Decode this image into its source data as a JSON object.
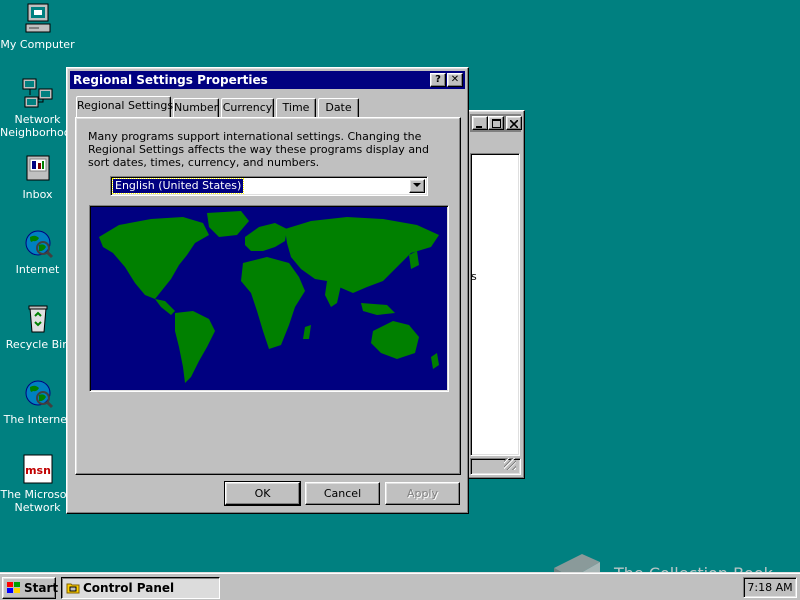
{
  "desktop_icons": [
    {
      "label": "My Computer",
      "icon": "my-computer-icon"
    },
    {
      "label": "Network Neighborhood",
      "icon": "network-neighborhood-icon"
    },
    {
      "label": "Inbox",
      "icon": "inbox-icon"
    },
    {
      "label": "Internet",
      "icon": "internet-icon"
    },
    {
      "label": "Recycle Bin",
      "icon": "recycle-bin-icon"
    },
    {
      "label": "The Internet",
      "icon": "the-internet-icon"
    },
    {
      "label": "The Microsoft Network",
      "icon": "msn-icon"
    }
  ],
  "dialog": {
    "title": "Regional Settings Properties",
    "help_glyph": "?",
    "close_glyph": "✕",
    "tabs": [
      {
        "label": "Regional Settings",
        "active": true
      },
      {
        "label": "Number",
        "active": false
      },
      {
        "label": "Currency",
        "active": false
      },
      {
        "label": "Time",
        "active": false
      },
      {
        "label": "Date",
        "active": false
      }
    ],
    "description": "Many programs support international settings. Changing the Regional Settings affects the way these programs display and sort dates, times, currency, and numbers.",
    "locale_value": "English (United States)",
    "buttons": {
      "ok": "OK",
      "cancel": "Cancel",
      "apply": "Apply"
    }
  },
  "background_window": {
    "title": "Control Panel",
    "fragment_text": "s"
  },
  "taskbar": {
    "start_label": "Start",
    "task_label": "Control Panel",
    "clock": "7:18 AM"
  },
  "watermark": {
    "text": "The Collection Book"
  },
  "colors": {
    "desktop": "#008080",
    "title_active": "#000080",
    "face": "#c0c0c0",
    "map_sea": "#000080",
    "map_land": "#008000"
  }
}
